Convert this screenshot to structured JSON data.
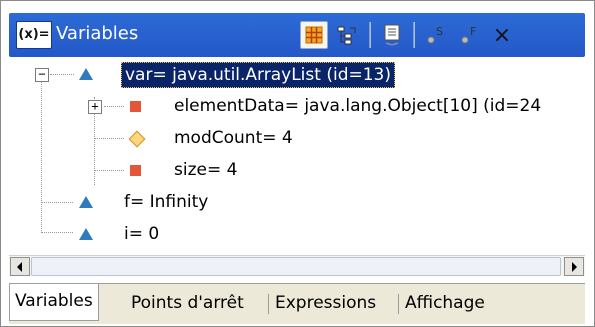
{
  "view": {
    "title": "Variables",
    "title_icon_text": "(x)=",
    "toolbar": [
      {
        "name": "show-type-names-icon",
        "pressed": true
      },
      {
        "name": "show-logical-structure-icon",
        "pressed": false
      },
      {
        "name": "collapse-all-icon",
        "pressed": false
      },
      {
        "name": "show-static-variables-icon",
        "label": "S"
      },
      {
        "name": "show-final-variables-icon",
        "label": "F"
      },
      {
        "name": "close-icon",
        "label": "×"
      }
    ]
  },
  "tree": {
    "rows": [
      {
        "text": "var= java.util.ArrayList  (id=13)",
        "icon": "local-variable-icon",
        "level": 0,
        "expander": "−",
        "selected": true
      },
      {
        "text": "elementData= java.lang.Object[10]  (id=24",
        "icon": "private-field-icon",
        "level": 1,
        "expander": "+"
      },
      {
        "text": "modCount= 4",
        "icon": "protected-field-icon",
        "level": 1
      },
      {
        "text": "size= 4",
        "icon": "private-field-icon",
        "level": 1
      },
      {
        "text": "f= Infinity",
        "icon": "local-variable-icon",
        "level": 0
      },
      {
        "text": "i= 0",
        "icon": "local-variable-icon",
        "level": 0
      }
    ]
  },
  "tabs": [
    {
      "label": "Variables",
      "active": true
    },
    {
      "label": "Points d'arrêt",
      "active": false
    },
    {
      "label": "Expressions",
      "active": false
    },
    {
      "label": "Affichage",
      "active": false
    }
  ],
  "colors": {
    "title_bar": "#2c6bd6",
    "selection": "#0a246a",
    "local_variable_icon": "#2f7bc0",
    "private_field_icon": "#e4563a",
    "protected_field_icon": "#fbd67a"
  }
}
